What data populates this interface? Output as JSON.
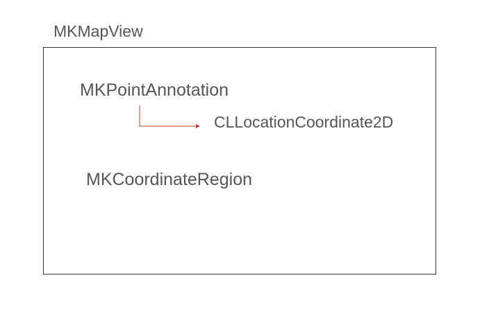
{
  "diagram": {
    "container_label": "MKMapView",
    "nodes": {
      "point_annotation": "MKPointAnnotation",
      "location_coordinate": "CLLocationCoordinate2D",
      "coordinate_region": "MKCoordinateRegion"
    },
    "connector_color": "#c0392b",
    "text_color": "#555555",
    "border_color": "#333333"
  }
}
